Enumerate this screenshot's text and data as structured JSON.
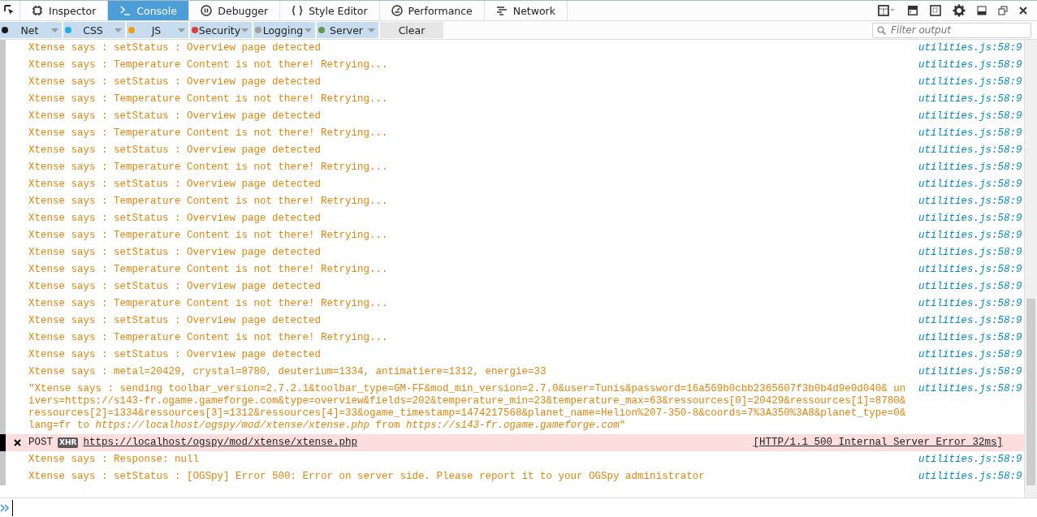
{
  "toolbar": {
    "tabs": [
      {
        "label": "Inspector",
        "selected": false
      },
      {
        "label": "Console",
        "selected": true
      },
      {
        "label": "Debugger",
        "selected": false
      },
      {
        "label": "Style Editor",
        "selected": false
      },
      {
        "label": "Performance",
        "selected": false
      },
      {
        "label": "Network",
        "selected": false
      }
    ]
  },
  "filter_bar": {
    "filters": [
      {
        "label": "Net",
        "color": "#1a1a1a",
        "checked": true
      },
      {
        "label": "CSS",
        "color": "#1ab1e6",
        "checked": true
      },
      {
        "label": "JS",
        "color": "#f39c12",
        "checked": true
      },
      {
        "label": "Security",
        "color": "#e43b3b",
        "checked": true
      },
      {
        "label": "Logging",
        "color": "#a0a0a0",
        "checked": true
      },
      {
        "label": "Server",
        "color": "#5e9a55",
        "checked": true
      }
    ],
    "clear": "Clear",
    "search": {
      "placeholder": "Filter output"
    }
  },
  "messages": [
    {
      "kind": "log",
      "text": "Xtense says : setStatus : Overview page detected",
      "location": "utilities.js:58:9"
    },
    {
      "kind": "log",
      "text": "Xtense says : Temperature Content is not there! Retrying...",
      "location": "utilities.js:58:9"
    },
    {
      "kind": "log",
      "text": "Xtense says : setStatus : Overview page detected",
      "location": "utilities.js:58:9"
    },
    {
      "kind": "log",
      "text": "Xtense says : Temperature Content is not there! Retrying...",
      "location": "utilities.js:58:9"
    },
    {
      "kind": "log",
      "text": "Xtense says : setStatus : Overview page detected",
      "location": "utilities.js:58:9"
    },
    {
      "kind": "log",
      "text": "Xtense says : Temperature Content is not there! Retrying...",
      "location": "utilities.js:58:9"
    },
    {
      "kind": "log",
      "text": "Xtense says : setStatus : Overview page detected",
      "location": "utilities.js:58:9"
    },
    {
      "kind": "log",
      "text": "Xtense says : Temperature Content is not there! Retrying...",
      "location": "utilities.js:58:9"
    },
    {
      "kind": "log",
      "text": "Xtense says : setStatus : Overview page detected",
      "location": "utilities.js:58:9"
    },
    {
      "kind": "log",
      "text": "Xtense says : Temperature Content is not there! Retrying...",
      "location": "utilities.js:58:9"
    },
    {
      "kind": "log",
      "text": "Xtense says : setStatus : Overview page detected",
      "location": "utilities.js:58:9"
    },
    {
      "kind": "log",
      "text": "Xtense says : Temperature Content is not there! Retrying...",
      "location": "utilities.js:58:9"
    },
    {
      "kind": "log",
      "text": "Xtense says : setStatus : Overview page detected",
      "location": "utilities.js:58:9"
    },
    {
      "kind": "log",
      "text": "Xtense says : Temperature Content is not there! Retrying...",
      "location": "utilities.js:58:9"
    },
    {
      "kind": "log",
      "text": "Xtense says : setStatus : Overview page detected",
      "location": "utilities.js:58:9"
    },
    {
      "kind": "log",
      "text": "Xtense says : Temperature Content is not there! Retrying...",
      "location": "utilities.js:58:9"
    },
    {
      "kind": "log",
      "text": "Xtense says : setStatus : Overview page detected",
      "location": "utilities.js:58:9"
    },
    {
      "kind": "log",
      "text": "Xtense says : Temperature Content is not there! Retrying...",
      "location": "utilities.js:58:9"
    },
    {
      "kind": "log",
      "text": "Xtense says : setStatus : Overview page detected",
      "location": "utilities.js:58:9"
    },
    {
      "kind": "log",
      "text": "Xtense says : metal=20429, crystal=8780, deuterium=1334, antimatiere=1312, energie=33",
      "location": "utilities.js:58:9"
    },
    {
      "kind": "log",
      "text": "\"Xtense says : sending toolbar_version=2.7.2.1&toolbar_type=GM-FF&mod_min_version=2.7.0&user=Tunis&password=16a569b0cbb2365607f3b0b4d9e0d040& univers=https://s143-fr.ogame.gameforge.com&type=overview&fields=202&temperature_min=23&temperature_max=63&ressources[0]=20429&ressources[1]=8780& ressources[2]=1334&ressources[3]=1312&ressources[4]=33&ogame_timestamp=1474217568&planet_name=Helion%207-350-8&coords=7%3A350%3A8&planet_type=0&lang=fr to *https://localhost/ogspy/mod/xtense/xtense.php* from *https://s143-fr.ogame.gameforge.com*\"",
      "location": "utilities.js:58:9"
    },
    {
      "kind": "network",
      "method": "POST",
      "badge": "XHR",
      "url": "https://localhost/ogspy/mod/xtense/xtense.php",
      "status": "[HTTP/1.1 500 Internal Server Error 32ms]"
    },
    {
      "kind": "log",
      "text": "Xtense says : Response: null",
      "location": "utilities.js:58:9"
    },
    {
      "kind": "log",
      "text": "Xtense says : setStatus : [OGSpy] Error 500: Error on server side. Please report it to your OGSpy administrator",
      "location": "utilities.js:58:9"
    }
  ]
}
